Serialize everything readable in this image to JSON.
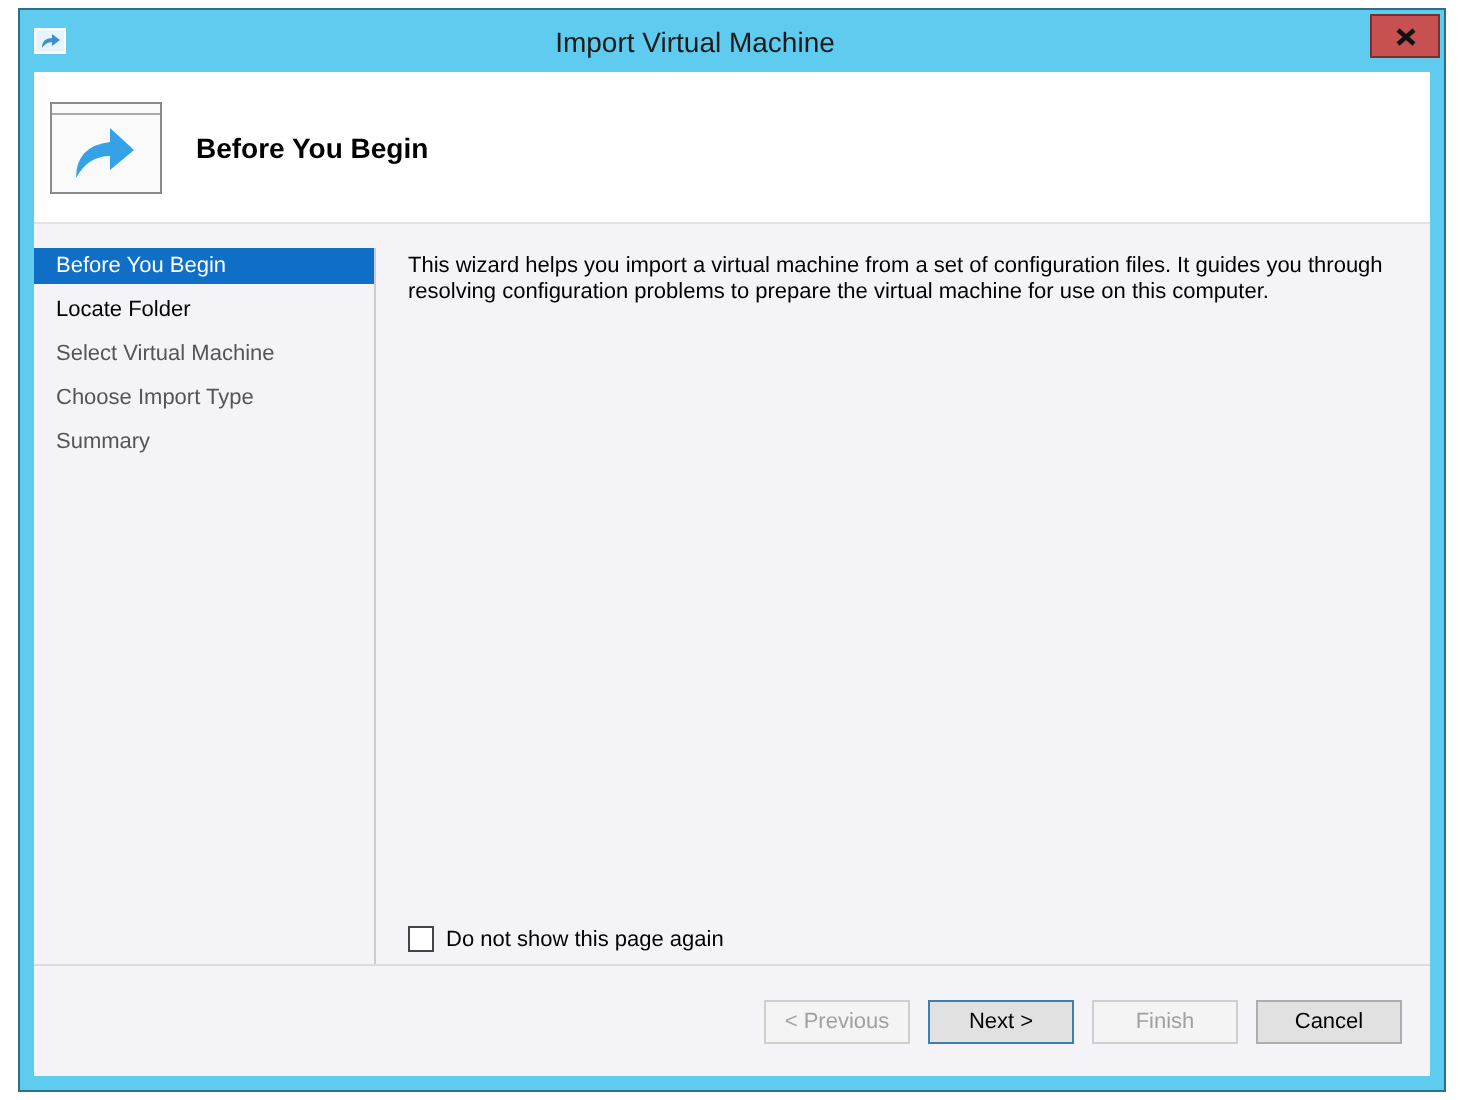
{
  "window": {
    "title": "Import Virtual Machine"
  },
  "header": {
    "title": "Before You Begin"
  },
  "steps": [
    {
      "label": "Before You Begin",
      "selected": true,
      "disabled": false
    },
    {
      "label": "Locate Folder",
      "selected": false,
      "disabled": false
    },
    {
      "label": "Select Virtual Machine",
      "selected": false,
      "disabled": true
    },
    {
      "label": "Choose Import Type",
      "selected": false,
      "disabled": true
    },
    {
      "label": "Summary",
      "selected": false,
      "disabled": true
    }
  ],
  "description": "This wizard helps you import a virtual machine from a set of configuration files. It guides you through resolving configuration problems to prepare the virtual machine for use on this computer.",
  "checkbox": {
    "label": "Do not show this page again",
    "checked": false
  },
  "buttons": [
    {
      "label": "< Previous",
      "disabled": true,
      "default": false
    },
    {
      "label": "Next >",
      "disabled": false,
      "default": true
    },
    {
      "label": "Finish",
      "disabled": true,
      "default": false
    },
    {
      "label": "Cancel",
      "disabled": false,
      "default": false
    }
  ]
}
